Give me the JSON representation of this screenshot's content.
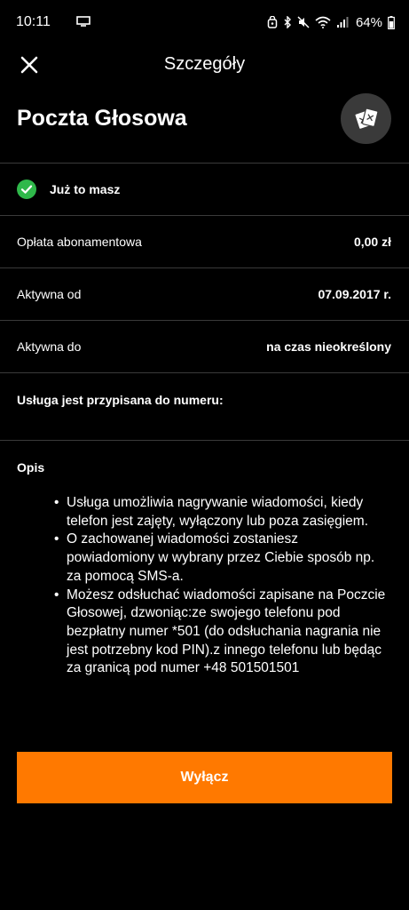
{
  "status_bar": {
    "time": "10:11",
    "battery": "64%",
    "icons": [
      "cast-tv-icon",
      "alarm-icon",
      "bluetooth-icon",
      "mute-icon",
      "wifi-icon",
      "signal-icon",
      "battery-icon"
    ]
  },
  "header": {
    "title": "Szczegóły",
    "close_icon": "close-icon"
  },
  "service": {
    "name": "Poczta Głosowa",
    "action_icon": "cards-icon"
  },
  "owned": {
    "label": "Już to masz",
    "icon": "check-circle-icon",
    "icon_color": "#2fb84a"
  },
  "details": [
    {
      "label": "Opłata abonamentowa",
      "value": "0,00 zł"
    },
    {
      "label": "Aktywna od",
      "value": "07.09.2017 r."
    },
    {
      "label": "Aktywna do",
      "value": "na czas nieokreślony"
    }
  ],
  "assigned_label": "Usługa jest przypisana do numeru:",
  "description": {
    "heading": "Opis",
    "items": [
      "Usługa umożliwia nagrywanie wiadomości, kiedy telefon jest zajęty, wyłączony lub poza zasięgiem.",
      "O zachowanej wiadomości zostaniesz powiadomiony w wybrany przez Ciebie sposób np. za pomocą SMS-a.",
      "Możesz odsłuchać wiadomości zapisane na Poczcie Głosowej, dzwoniąc:ze swojego telefonu pod bezpłatny numer *501 (do odsłuchania nagrania nie jest potrzebny kod PIN).z innego telefonu lub będąc za granicą pod numer +48 501501501"
    ]
  },
  "primary_button": {
    "label": "Wyłącz",
    "color": "#ff7900"
  }
}
